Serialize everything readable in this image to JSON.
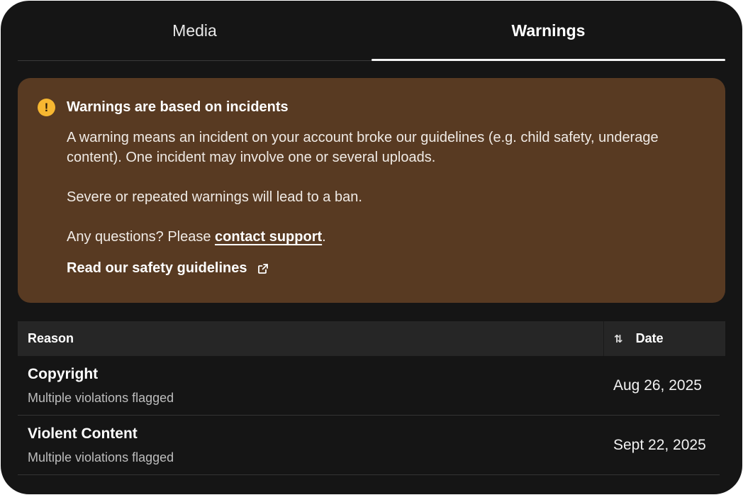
{
  "tabs": [
    {
      "label": "Media",
      "active": false
    },
    {
      "label": "Warnings",
      "active": true
    }
  ],
  "banner": {
    "icon": "exclamation-icon",
    "title": "Warnings are based on incidents",
    "paragraph1": "A warning means an incident on your account broke our guidelines (e.g. child safety, underage content). One incident may involve one or several uploads.",
    "paragraph2": "Severe or repeated warnings will lead to a ban.",
    "paragraph3_prefix": "Any questions? Please ",
    "paragraph3_link": "contact support",
    "paragraph3_suffix": ".",
    "guidelines_link": "Read our safety guidelines",
    "background_color": "#583a22",
    "icon_color": "#f7b731"
  },
  "table": {
    "headers": {
      "reason": "Reason",
      "date": "Date"
    },
    "rows": [
      {
        "reason": "Copyright",
        "detail": "Multiple violations flagged",
        "date": "Aug 26, 2025"
      },
      {
        "reason": "Violent Content",
        "detail": "Multiple violations flagged",
        "date": "Sept 22, 2025"
      }
    ]
  }
}
